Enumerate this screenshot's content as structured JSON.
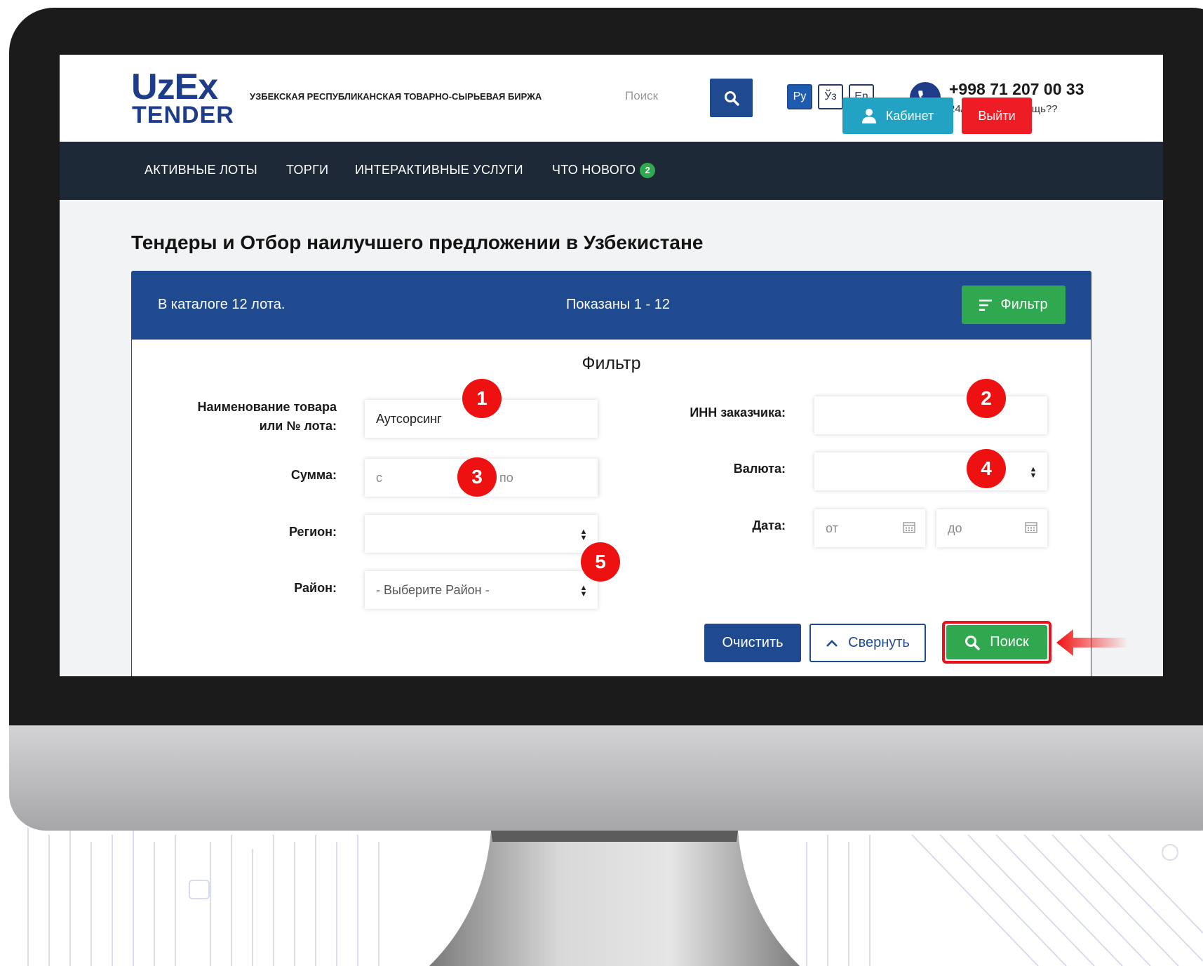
{
  "header": {
    "logo_top": "UzEx",
    "logo_bottom": "TENDER",
    "org_name": "УЗБЕКСКАЯ РЕСПУБЛИКАНСКАЯ ТОВАРНО-СЫРЬЕВАЯ БИРЖА",
    "search_placeholder": "Поиск",
    "languages": [
      "Ру",
      "Ўз",
      "En"
    ],
    "active_language": "Ру",
    "phone": "+998 71 207 00 33",
    "help_text": "24/7 Нужна помощь??"
  },
  "nav": {
    "items": [
      "АКТИВНЫЕ ЛОТЫ",
      "ТОРГИ",
      "ИНТЕРАКТИВНЫЕ УСЛУГИ",
      "ЧТО НОВОГО"
    ],
    "news_badge": "2",
    "cabinet_label": "Кабинет",
    "logout_label": "Выйти"
  },
  "page_title": "Тендеры и Отбор наилучшего предложении в Узбекистане",
  "catalog": {
    "count_text": "В каталоге 12 лота.",
    "shown_text": "Показаны 1 - 12",
    "filter_button": "Фильтр"
  },
  "filter": {
    "heading": "Фильтр",
    "name_label_line1": "Наименование товара",
    "name_label_line2": "или № лота:",
    "name_value": "Аутсорсинг",
    "sum_label": "Сумма:",
    "sum_from_placeholder": "с",
    "sum_to_placeholder": "по",
    "region_label": "Регион:",
    "region_value": "",
    "district_label": "Район:",
    "district_value": "- Выберите Район -",
    "inn_label": "ИНН заказчика:",
    "inn_value": "",
    "currency_label": "Валюта:",
    "currency_value": "",
    "date_label": "Дата:",
    "date_from_placeholder": "от",
    "date_to_placeholder": "до",
    "clear_button": "Очистить",
    "collapse_button": "Свернуть",
    "search_button": "Поиск"
  },
  "annotations": [
    "1",
    "2",
    "3",
    "4",
    "5"
  ],
  "colors": {
    "brand_blue": "#1f4a8f",
    "nav_dark": "#1e2938",
    "green": "#2fa84f",
    "cabinet_teal": "#23a3c4",
    "red": "#ee1c24"
  }
}
